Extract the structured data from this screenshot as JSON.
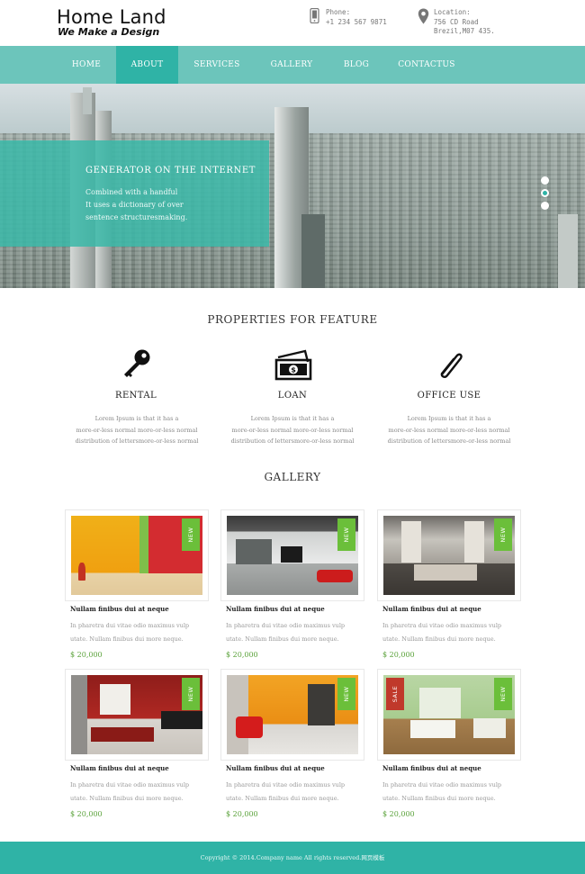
{
  "header": {
    "logo_title": "Home Land",
    "logo_subtitle": "We Make a Design",
    "phone": {
      "label": "Phone:",
      "value": "+1 234 567 9871"
    },
    "location": {
      "label": "Location:",
      "line1": "756 CD Road",
      "line2": "Brezil,M07 435."
    }
  },
  "nav": {
    "items": [
      {
        "label": "HOME"
      },
      {
        "label": "ABOUT",
        "active": true
      },
      {
        "label": "SERVICES"
      },
      {
        "label": "GALLERY"
      },
      {
        "label": "BLOG"
      },
      {
        "label": "CONTACTUS"
      }
    ]
  },
  "hero": {
    "title": "GENERATOR ON THE INTERNET",
    "lines": [
      "Combined with a handful",
      "It uses a dictionary of over",
      "sentence structuresmaking."
    ],
    "slides": 3,
    "active_slide": 2
  },
  "properties": {
    "title": "PROPERTIES FOR FEATURE",
    "items": [
      {
        "label": "RENTAL",
        "icon": "key-icon",
        "desc": [
          "Lorem Ipsum is that it has a",
          "more-or-less normal more-or-less normal",
          "distribution of lettersmore-or-less normal"
        ]
      },
      {
        "label": "LOAN",
        "icon": "money-icon",
        "desc": [
          "Lorem Ipsum is that it has a",
          "more-or-less normal more-or-less normal",
          "distribution of lettersmore-or-less normal"
        ]
      },
      {
        "label": "OFFICE USE",
        "icon": "paperclip-icon",
        "desc": [
          "Lorem Ipsum is that it has a",
          "more-or-less normal more-or-less normal",
          "distribution of lettersmore-or-less normal"
        ]
      }
    ]
  },
  "gallery": {
    "title": "GALLERY",
    "items": [
      {
        "badge": "NEW",
        "title": "Nullam finibus dui at neque",
        "desc": [
          "In pharetra dui vitae odio maximus vulp",
          "utate. Nullam finibus dui more neque."
        ],
        "price": "$ 20,000"
      },
      {
        "badge": "NEW",
        "title": "Nullam finibus dui at neque",
        "desc": [
          "In pharetra dui vitae odio maximus vulp",
          "utate. Nullam finibus dui more neque."
        ],
        "price": "$ 20,000"
      },
      {
        "badge": "NEW",
        "title": "Nullam finibus dui at neque",
        "desc": [
          "In pharetra dui vitae odio maximus vulp",
          "utate. Nullam finibus dui more neque."
        ],
        "price": "$ 20,000"
      },
      {
        "badge": "NEW",
        "title": "Nullam finibus dui at neque",
        "desc": [
          "In pharetra dui vitae odio maximus vulp",
          "utate. Nullam finibus dui more neque."
        ],
        "price": "$ 20,000"
      },
      {
        "badge": "NEW",
        "title": "Nullam finibus dui at neque",
        "desc": [
          "In pharetra dui vitae odio maximus vulp",
          "utate. Nullam finibus dui more neque."
        ],
        "price": "$ 20,000"
      },
      {
        "badge": "NEW",
        "badge_left": "SALE",
        "title": "Nullam finibus dui at neque",
        "desc": [
          "In pharetra dui vitae odio maximus vulp",
          "utate. Nullam finibus dui more neque."
        ],
        "price": "$ 20,000"
      }
    ]
  },
  "footer": {
    "copyright": "Copyright © 2014.Company name All rights reserved.网页模板"
  },
  "colors": {
    "nav_bg": "#6cc5bb",
    "accent": "#2fb3a6",
    "badge_new": "#6bbf3a",
    "badge_sale": "#c0392b",
    "price": "#5aa23a"
  }
}
